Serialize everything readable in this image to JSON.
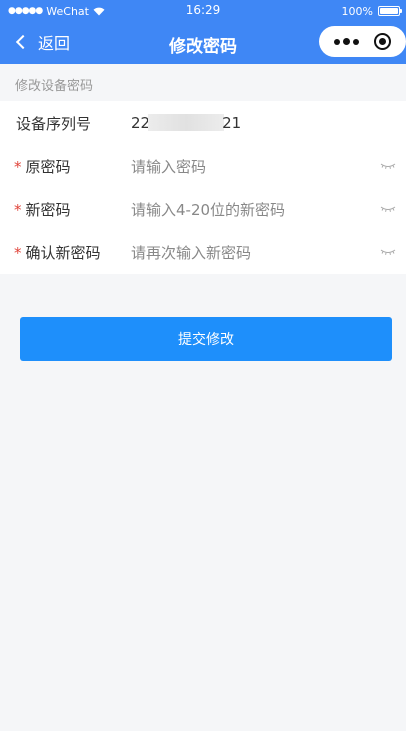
{
  "status_bar": {
    "carrier": "WeChat",
    "time": "16:29",
    "battery": "100%"
  },
  "navbar": {
    "back_label": "返回",
    "title": "修改密码"
  },
  "section": {
    "label": "修改设备密码"
  },
  "form": {
    "serial": {
      "label": "设备序列号",
      "value_prefix": "22",
      "value_suffix": "21"
    },
    "old_password": {
      "label": "原密码",
      "placeholder": "请输入密码"
    },
    "new_password": {
      "label": "新密码",
      "placeholder": "请输入4-20位的新密码"
    },
    "confirm_password": {
      "label": "确认新密码",
      "placeholder": "请再次输入新密码"
    },
    "required_mark": "*"
  },
  "submit_label": "提交修改",
  "colors": {
    "nav_background": "#3f87f5",
    "button": "#1e8ffb",
    "required": "#e0443a",
    "page_background": "#f5f6f8"
  },
  "icons": {
    "password_toggle": "eye-closed-icon",
    "back": "chevron-left-icon",
    "menu": "more-dots-icon",
    "close": "target-circle-icon"
  }
}
